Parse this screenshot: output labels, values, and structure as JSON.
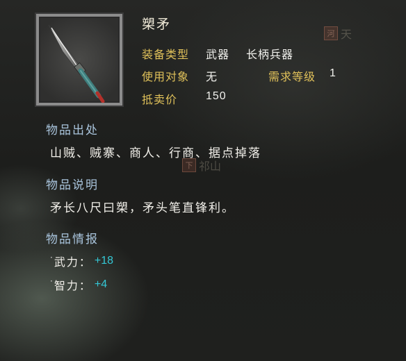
{
  "map": {
    "label_top_right": "天",
    "seal_top_right": "河",
    "label_mid": "祁山",
    "seal_mid": "下"
  },
  "item": {
    "name": "槊矛",
    "icon": "spear-icon",
    "equip_type_label": "装备类型",
    "equip_type_value": "武器",
    "equip_subtype_value": "长柄兵器",
    "user_label": "使用对象",
    "user_value": "无",
    "level_req_label": "需求等级",
    "level_req_value": "1",
    "price_label": "抵卖价",
    "price_value": "150"
  },
  "sections": {
    "origin_title": "物品出处",
    "origin_text": "山贼、贼寨、商人、行商、据点掉落",
    "desc_title": "物品说明",
    "desc_text": "矛长八尺曰槊，矛头笔直锋利。",
    "intel_title": "物品情报"
  },
  "stats": [
    {
      "name": "武力：",
      "value": "+18"
    },
    {
      "name": "智力：",
      "value": "+4"
    }
  ],
  "colors": {
    "label": "#e0c15a",
    "section": "#a9c4dc",
    "stat_value": "#34c8d6"
  }
}
